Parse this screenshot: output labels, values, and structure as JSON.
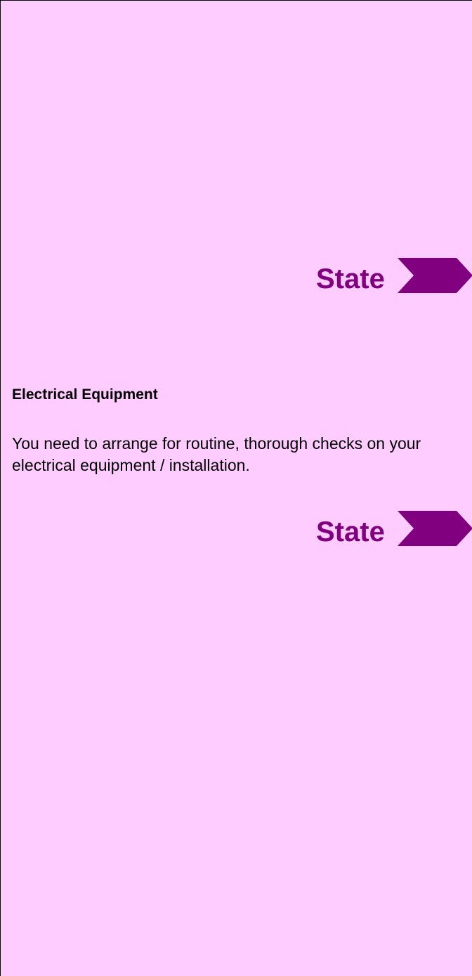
{
  "markers": {
    "top_label": "State",
    "bottom_label": "State",
    "accent_color": "#800080",
    "background_color": "#ffccff",
    "icon": "chevron-right-icon"
  },
  "content": {
    "heading": "Electrical Equipment",
    "body": "You need to arrange for routine, thorough checks on your electrical equipment / installation."
  }
}
